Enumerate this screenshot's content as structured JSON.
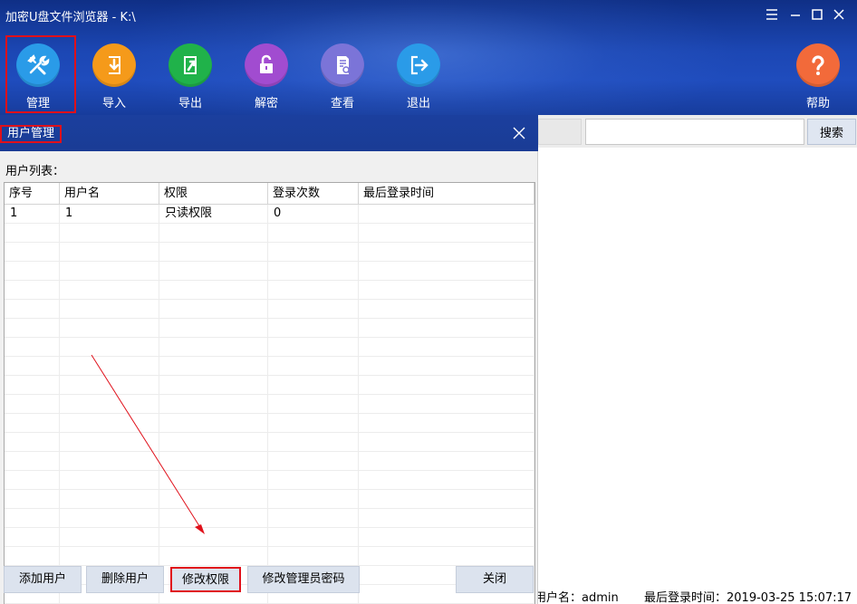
{
  "window": {
    "title": "加密U盘文件浏览器 - K:\\"
  },
  "toolbar": {
    "manage": "管理",
    "import": "导入",
    "export": "导出",
    "decrypt": "解密",
    "view": "查看",
    "exit": "退出",
    "help": "帮助"
  },
  "icons": {
    "manage": "tools-icon",
    "import": "import-arrow-icon",
    "export": "export-arrow-icon",
    "decrypt": "unlock-icon",
    "view": "document-search-icon",
    "exit": "exit-door-icon",
    "help": "question-mark-icon"
  },
  "colors": {
    "manage": "#2a9be8",
    "import": "#f59a1a",
    "export": "#20b24a",
    "decrypt": "#a14cd0",
    "view": "#7b74d8",
    "exit": "#2a9be8",
    "help": "#f26a3a",
    "highlight": "#e0101a"
  },
  "search": {
    "button_label": "搜索",
    "value": ""
  },
  "dialog": {
    "title": "用户管理",
    "list_label": "用户列表：",
    "columns": [
      "序号",
      "用户名",
      "权限",
      "登录次数",
      "最后登录时间"
    ],
    "rows": [
      [
        "1",
        "1",
        "只读权限",
        "0",
        ""
      ]
    ],
    "buttons": {
      "add_user": "添加用户",
      "delete_user": "删除用户",
      "modify_permission": "修改权限",
      "modify_admin_password": "修改管理员密码",
      "close": "关闭"
    }
  },
  "status": {
    "user": "用户名：admin",
    "last_login": "最后登录时间：2019-03-25 15:07:17"
  }
}
